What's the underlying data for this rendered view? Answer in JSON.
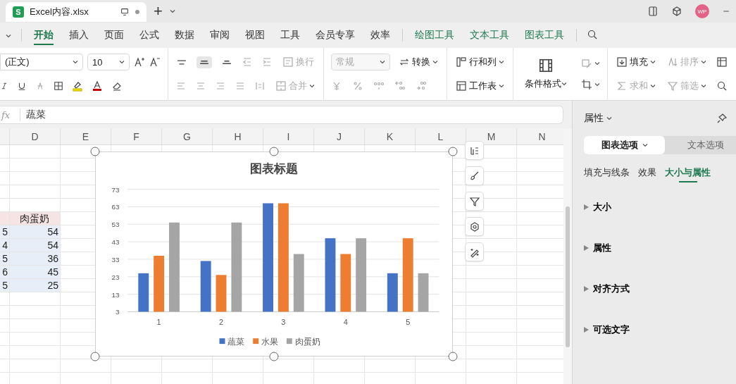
{
  "title_bar": {
    "app_logo": "S",
    "tabs": [
      {
        "label": "Excel内容.xlsx",
        "selected": true
      }
    ],
    "new_tab": "+",
    "avatar": "WP"
  },
  "menu": {
    "tabs": [
      {
        "label": "开始",
        "selected": true,
        "kind": "main"
      },
      {
        "label": "插入",
        "selected": false,
        "kind": "main"
      },
      {
        "label": "页面",
        "selected": false,
        "kind": "main"
      },
      {
        "label": "公式",
        "selected": false,
        "kind": "main"
      },
      {
        "label": "数据",
        "selected": false,
        "kind": "main"
      },
      {
        "label": "审阅",
        "selected": false,
        "kind": "main"
      },
      {
        "label": "视图",
        "selected": false,
        "kind": "main"
      },
      {
        "label": "工具",
        "selected": false,
        "kind": "main"
      },
      {
        "label": "会员专享",
        "selected": false,
        "kind": "main"
      },
      {
        "label": "效率",
        "selected": false,
        "kind": "main"
      },
      {
        "label": "绘图工具",
        "selected": false,
        "kind": "tool"
      },
      {
        "label": "文本工具",
        "selected": false,
        "kind": "tool"
      },
      {
        "label": "图表工具",
        "selected": false,
        "kind": "tool"
      }
    ]
  },
  "ribbon": {
    "font_name": "(正文)",
    "font_size": "10",
    "wrap": {
      "label": "换行",
      "disabled": true
    },
    "merge": {
      "label": "合并",
      "disabled": true
    },
    "number_format": {
      "value": "常规",
      "disabled": true
    },
    "convert": {
      "label": "转换",
      "disabled": false
    },
    "rows_cols": {
      "label": "行和列",
      "disabled": false
    },
    "sheet": {
      "label": "工作表",
      "disabled": false
    },
    "cond_format": {
      "label": "条件格式",
      "disabled": false
    },
    "fill": {
      "label": "填充",
      "disabled": false
    },
    "sort": {
      "label": "排序",
      "disabled": true
    },
    "sum": {
      "label": "求和",
      "disabled": true
    },
    "filter": {
      "label": "筛选",
      "disabled": true
    }
  },
  "formula_bar": {
    "fx": "fx",
    "value": "蔬菜"
  },
  "sheet": {
    "columns": [
      "D",
      "E",
      "F",
      "G",
      "H",
      "I",
      "J",
      "K",
      "L",
      "M",
      "N"
    ],
    "table_rows": [
      {
        "kind": "header",
        "cells": [
          "",
          "肉蛋奶"
        ]
      },
      {
        "kind": "data",
        "cells": [
          "5",
          "54"
        ]
      },
      {
        "kind": "data",
        "cells": [
          "4",
          "54"
        ]
      },
      {
        "kind": "data",
        "cells": [
          "5",
          "36"
        ]
      },
      {
        "kind": "data",
        "cells": [
          "6",
          "45"
        ]
      },
      {
        "kind": "data",
        "cells": [
          "5",
          "25"
        ]
      }
    ],
    "chart": {
      "chart_data": {
        "type": "bar",
        "title": "图表标题",
        "categories": [
          "1",
          "2",
          "3",
          "4",
          "5"
        ],
        "series": [
          {
            "name": "蔬菜",
            "color": "#4472c4",
            "values": [
              25,
              32,
              65,
              45,
              25
            ]
          },
          {
            "name": "水果",
            "color": "#ed7d31",
            "values": [
              35,
              24,
              65,
              36,
              45
            ]
          },
          {
            "name": "肉蛋奶",
            "color": "#a5a5a5",
            "values": [
              54,
              54,
              36,
              45,
              25
            ]
          }
        ],
        "ylim": [
          3,
          73
        ],
        "yticks": [
          3,
          13,
          23,
          33,
          43,
          53,
          63,
          73
        ],
        "grid": true,
        "legend": true
      }
    }
  },
  "panel": {
    "title": "属性",
    "option_tabs": [
      {
        "label": "图表选项",
        "selected": true
      },
      {
        "label": "文本选项",
        "selected": false
      }
    ],
    "sub_tabs": [
      {
        "label": "填充与线条",
        "selected": false
      },
      {
        "label": "效果",
        "selected": false
      },
      {
        "label": "大小与属性",
        "selected": true
      }
    ],
    "sections": [
      {
        "label": "大小",
        "expanded": false
      },
      {
        "label": "属性",
        "expanded": false
      },
      {
        "label": "对齐方式",
        "expanded": false
      },
      {
        "label": "可选文字",
        "expanded": false
      }
    ]
  }
}
